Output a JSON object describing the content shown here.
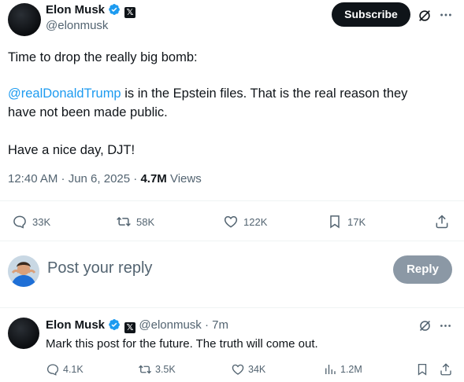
{
  "main_post": {
    "author_name": "Elon Musk",
    "author_handle": "@elonmusk",
    "subscribe_label": "Subscribe",
    "text_line1": "Time to drop the really big bomb:",
    "mention": "@realDonaldTrump",
    "text_line2_rest": " is in the Epstein files. That is the real reason they",
    "text_line3": "have not been made public.",
    "text_line4": "Have a nice day, DJT!",
    "timestamp": "12:40 AM · Jun 6, 2025 · ",
    "views_count": "4.7M",
    "views_label": " Views",
    "actions": {
      "replies": "33K",
      "reposts": "58K",
      "likes": "122K",
      "bookmarks": "17K"
    }
  },
  "reply_box": {
    "placeholder": "Post your reply",
    "button_label": "Reply"
  },
  "reply_post": {
    "author_name": "Elon Musk",
    "author_handle": "@elonmusk",
    "time": " · 7m",
    "text": "Mark this post for the future. The truth will come out.",
    "actions": {
      "replies": "4.1K",
      "reposts": "3.5K",
      "likes": "34K",
      "views": "1.2M"
    }
  },
  "colors": {
    "text": "#0f1419",
    "secondary": "#536471",
    "link": "#1d9bf0",
    "verified": "#1d9bf0",
    "reply_button_disabled": "#8b98a5"
  }
}
